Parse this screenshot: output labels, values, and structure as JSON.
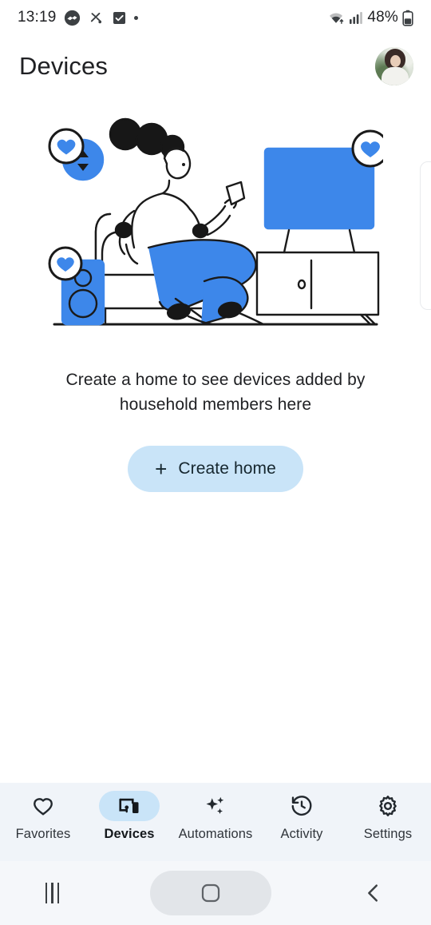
{
  "status_bar": {
    "time": "13:19",
    "battery_percent": "48%",
    "icons": [
      "handshake-icon",
      "mute-alarm-icon",
      "checkbox-icon",
      "dot-indicator",
      "wifi-icon",
      "cellular-signal-icon",
      "battery-icon"
    ]
  },
  "header": {
    "title": "Devices",
    "avatar_label": "account-avatar"
  },
  "illustration": {
    "name": "home-devices-illustration",
    "alt": "Person sitting in a chair holding a phone with a TV, speaker and thermostat nearby",
    "accent_blue": "#3d87ea",
    "badge_count": 3,
    "devices": [
      "thermostat",
      "speaker",
      "television"
    ]
  },
  "empty_state": {
    "message": "Create a home to see devices added by household members here"
  },
  "cta": {
    "plus": "+",
    "label": "Create home",
    "background": "#c9e4f8"
  },
  "bottom_nav": {
    "active_index": 1,
    "items": [
      {
        "label": "Favorites",
        "icon": "heart-icon"
      },
      {
        "label": "Devices",
        "icon": "devices-icon"
      },
      {
        "label": "Automations",
        "icon": "sparkles-icon"
      },
      {
        "label": "Activity",
        "icon": "history-icon"
      },
      {
        "label": "Settings",
        "icon": "gear-icon"
      }
    ]
  },
  "system_nav": {
    "recents": "recents-button",
    "home": "home-button",
    "back": "back-button"
  }
}
